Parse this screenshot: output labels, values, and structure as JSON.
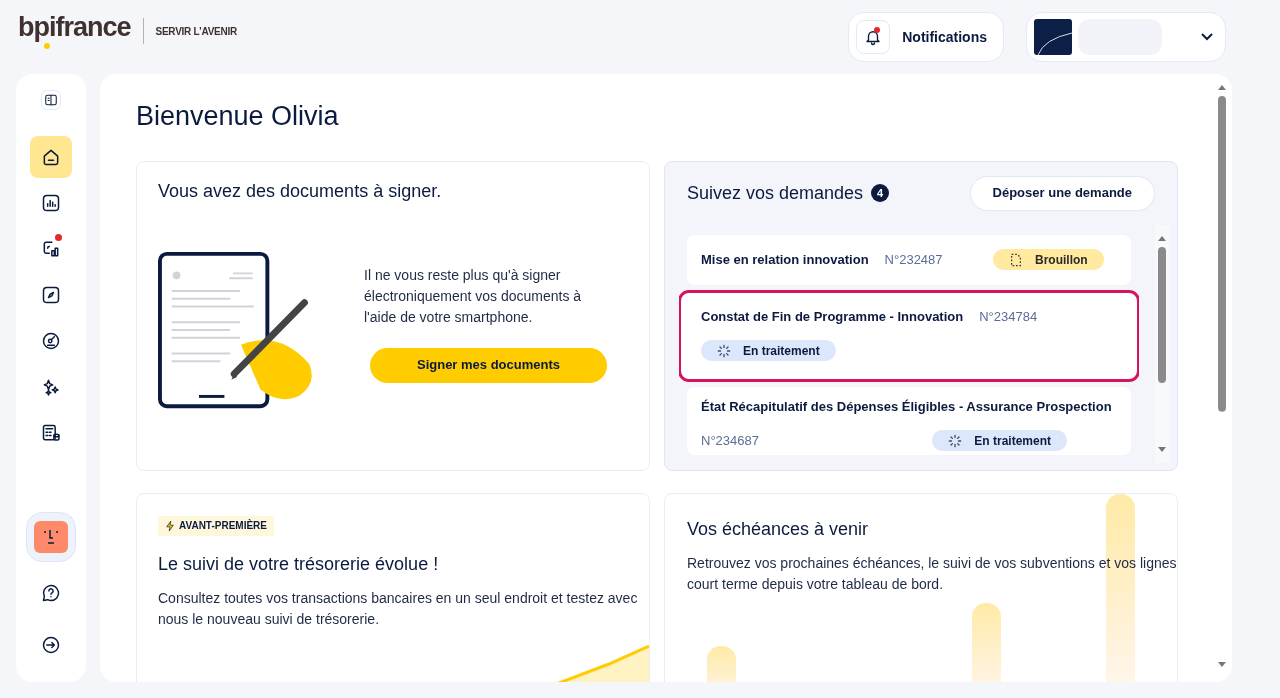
{
  "header": {
    "logo": "bpifrance",
    "tagline": "SERVIR L’AVENIR",
    "notifications": {
      "label": "Notifications",
      "unread": true
    }
  },
  "sidebar": {
    "items": [
      {
        "selected": true,
        "badge": false
      },
      {
        "selected": false,
        "badge": false
      },
      {
        "selected": false,
        "badge": true
      },
      {
        "selected": false,
        "badge": false
      },
      {
        "selected": false,
        "badge": false
      },
      {
        "selected": false,
        "badge": false
      },
      {
        "selected": false,
        "badge": false
      }
    ]
  },
  "main": {
    "title": "Bienvenue Olivia",
    "sign_card": {
      "title": "Vous avez des documents à signer.",
      "text": "Il ne vous reste plus qu'à signer électroniquement vos documents à l'aide de votre smartphone.",
      "button": "Signer mes documents"
    },
    "requests": {
      "title": "Suivez vos demandes",
      "count": "4",
      "button": "Déposer une demande",
      "items": [
        {
          "kind": "inline",
          "title": "Mise en relation innovation",
          "number": "N°232487",
          "highlighted": false,
          "status": {
            "kind": "draft",
            "label": "Brouillon"
          }
        },
        {
          "kind": "stacked",
          "title": "Constat de Fin de Programme - Innovation",
          "number": "N°234784",
          "highlighted": true,
          "status": {
            "kind": "processing",
            "label": "En traitement"
          }
        },
        {
          "kind": "split",
          "title": "État Récapitulatif des Dépenses Éligibles - Assurance Prospection",
          "number": "N°234687",
          "highlighted": false,
          "status": {
            "kind": "processing",
            "label": "En traitement"
          }
        }
      ]
    },
    "treasury_card": {
      "tag": "AVANT-PREMIÈRE",
      "title": "Le suivi de votre trésorerie évolue !",
      "text": "Consultez toutes vos transactions bancaires en un seul endroit et testez avec nous le nouveau suivi de trésorerie."
    },
    "deadlines_card": {
      "title": "Vos échéances à venir",
      "text": "Retrouvez vos prochaines échéances, le suivi de vos subventions et vos lignes court terme depuis votre tableau de bord."
    }
  }
}
